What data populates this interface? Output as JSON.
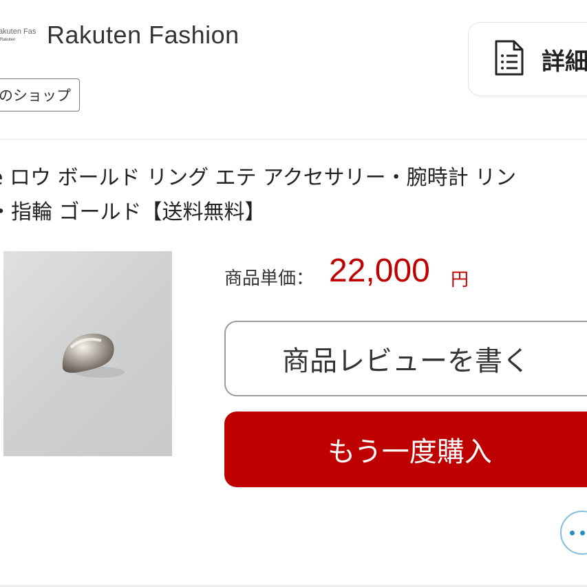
{
  "header": {
    "logo_text": "Rakuten Fashion",
    "logo_subtext": "Rakuten",
    "shop_name": "Rakuten Fashion",
    "shop_button_label": "のショップ",
    "details_button_label": "詳細"
  },
  "product": {
    "title_line1": "e ロウ ボールド リング エテ アクセサリー・腕時計 リン",
    "title_line2": "・指輪 ゴールド【送料無料】",
    "price_label": "商品単価：",
    "price_value": "22,000",
    "price_unit": "円"
  },
  "actions": {
    "review_label": "商品レビューを書く",
    "rebuy_label": "もう一度購入"
  },
  "icons": {
    "details": "document-icon",
    "more": "more-dots-icon"
  },
  "colors": {
    "accent": "#bf0000",
    "more_dot": "#1f8fc4"
  }
}
